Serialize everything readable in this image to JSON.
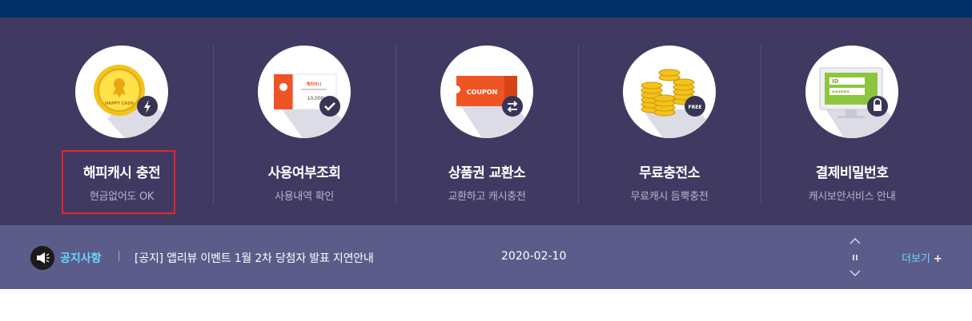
{
  "menu": {
    "items": [
      {
        "title": "해피캐시 충전",
        "subtitle": "현금없어도 OK",
        "icon": "happy-cash-coin-icon",
        "badge_icon": "lightning-icon",
        "coin_text": "HAPPY CASH"
      },
      {
        "title": "사용여부조회",
        "subtitle": "사용내역 확인",
        "icon": "happy-cash-card-icon",
        "badge_icon": "check-icon",
        "card_text": "10,000",
        "card_brand": "해피머니"
      },
      {
        "title": "상품권 교환소",
        "subtitle": "교환하고 캐시충전",
        "icon": "coupon-icon",
        "badge_icon": "exchange-icon",
        "coupon_text": "COUPON"
      },
      {
        "title": "무료충전소",
        "subtitle": "무료캐시 듬뿍충전",
        "icon": "coin-stack-icon",
        "badge_icon": "free-badge-icon",
        "badge_text": "FREE"
      },
      {
        "title": "결제비밀번호",
        "subtitle": "캐시보안서비스 안내",
        "icon": "monitor-password-icon",
        "badge_icon": "lock-icon",
        "screen_id": "ID",
        "screen_pw": "******"
      }
    ]
  },
  "notice": {
    "label": "공지사항",
    "text": "[공지] 앱리뷰 이벤트 1월 2차 당첨자 발표 지연안내",
    "date": "2020-02-10",
    "more_label": "더보기",
    "more_plus": "+"
  },
  "colors": {
    "top_bar": "#003067",
    "menu_bg": "#403a62",
    "notice_bg": "#5c5c8a",
    "accent_cyan": "#66d8ff",
    "highlight": "#e2262b"
  }
}
